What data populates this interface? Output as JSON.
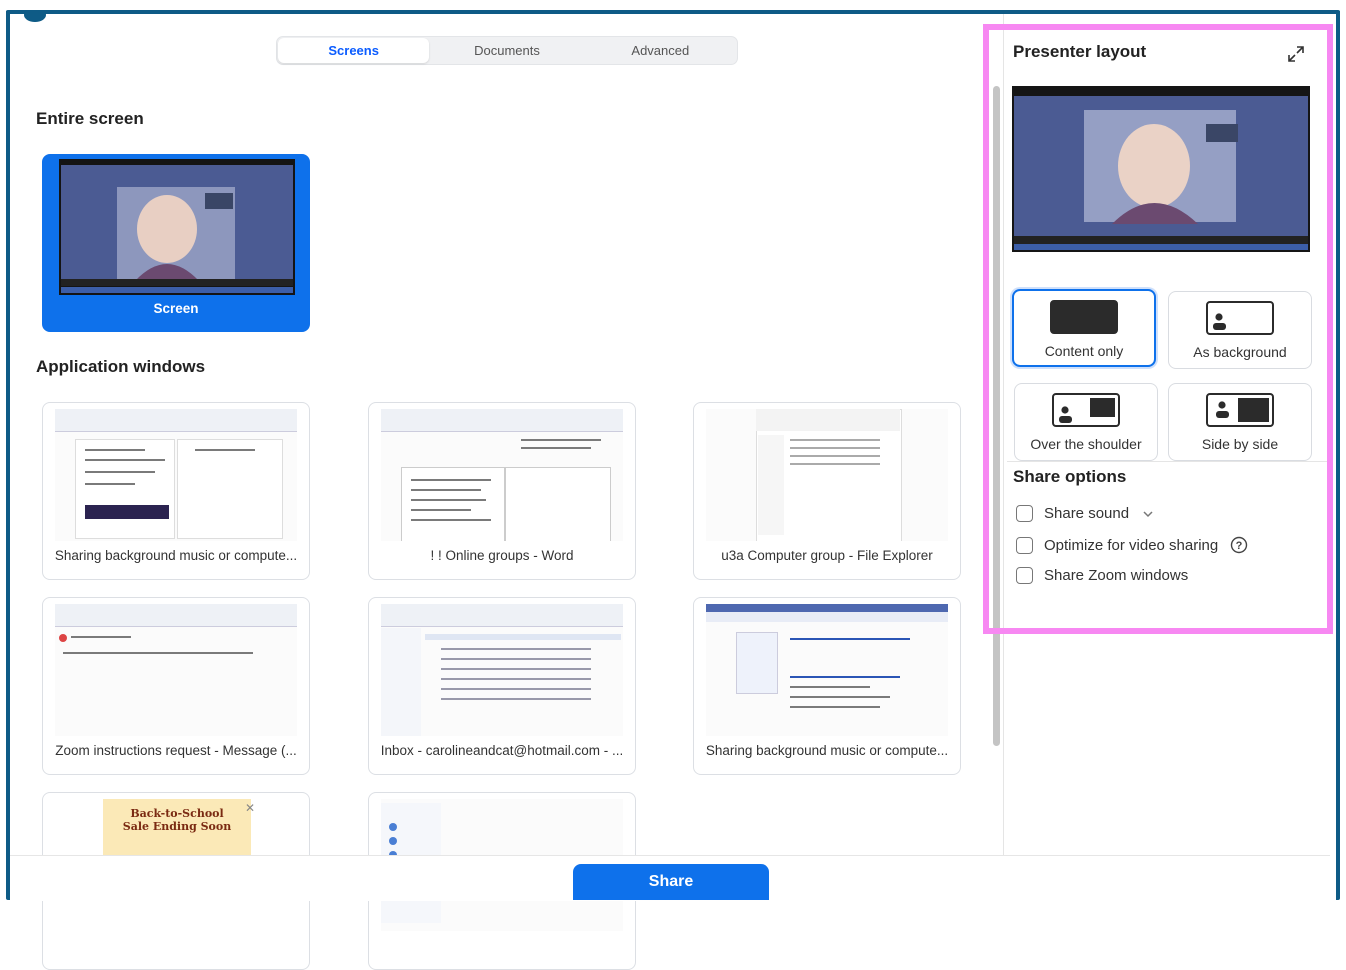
{
  "tabs": [
    {
      "label": "Screens",
      "active": true
    },
    {
      "label": "Documents",
      "active": false
    },
    {
      "label": "Advanced",
      "active": false
    }
  ],
  "entire_screen": {
    "heading": "Entire screen",
    "screen_label": "Screen"
  },
  "apps": {
    "heading": "Application windows",
    "items": [
      {
        "label": "Sharing background music or compute..."
      },
      {
        "label": "! ! Online groups - Word"
      },
      {
        "label": "u3a Computer group - File Explorer"
      },
      {
        "label": "Zoom instructions request - Message (..."
      },
      {
        "label": "Inbox - carolineandcat@hotmail.com - ..."
      },
      {
        "label": "Sharing background music or compute..."
      },
      {
        "label": "Back-to-School Sale Ending Soon"
      },
      {
        "label": ""
      }
    ]
  },
  "presenter": {
    "title": "Presenter layout",
    "options": [
      {
        "label": "Content only",
        "selected": true
      },
      {
        "label": "As background",
        "selected": false
      },
      {
        "label": "Over the shoulder",
        "selected": false
      },
      {
        "label": "Side by side",
        "selected": false
      }
    ]
  },
  "share_options": {
    "heading": "Share options",
    "items": [
      {
        "label": "Share sound",
        "checked": false
      },
      {
        "label": "Optimize for video sharing",
        "checked": false
      },
      {
        "label": "Share Zoom windows",
        "checked": false
      }
    ]
  },
  "share_button": "Share",
  "colors": {
    "accent": "#0e71eb",
    "frame": "#0e5b86",
    "highlight": "#f788f2"
  }
}
